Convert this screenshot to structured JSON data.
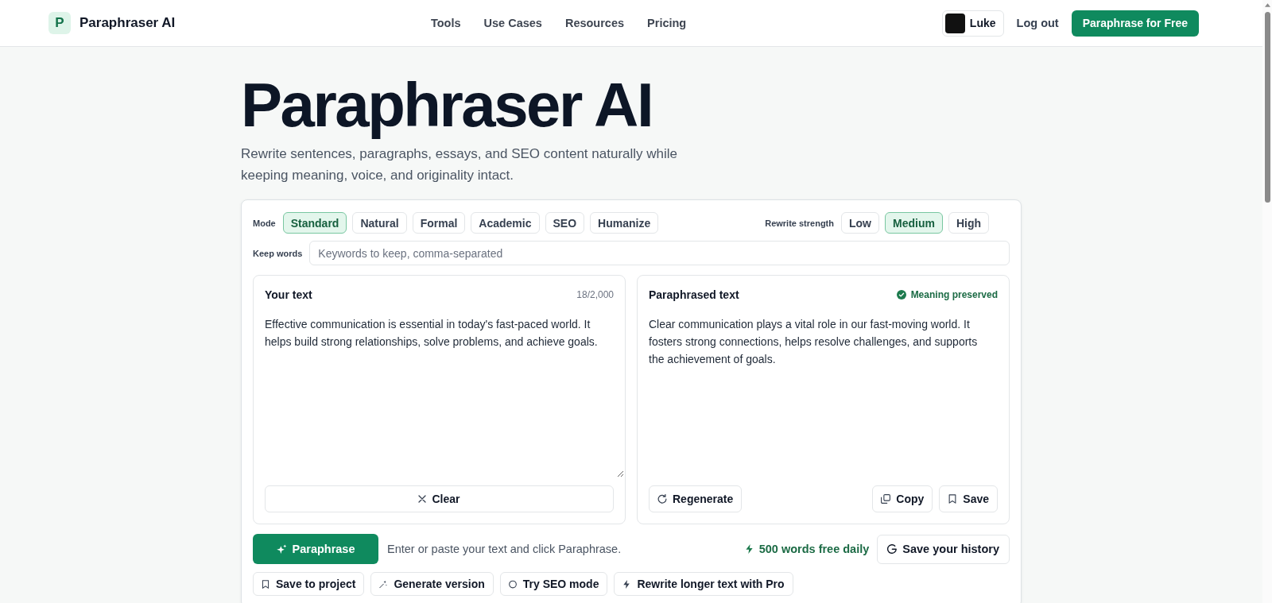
{
  "header": {
    "logo_letter": "P",
    "brand": "Paraphraser AI",
    "nav": [
      {
        "label": "Tools"
      },
      {
        "label": "Use Cases"
      },
      {
        "label": "Resources"
      },
      {
        "label": "Pricing"
      }
    ],
    "user": {
      "name": "Luke"
    },
    "logout": "Log out",
    "cta": "Paraphrase for Free"
  },
  "hero": {
    "title": "Paraphraser AI",
    "subtitle": "Rewrite sentences, paragraphs, essays, and SEO content naturally while keeping meaning, voice, and originality intact."
  },
  "controls": {
    "mode_label": "Mode",
    "modes": [
      {
        "label": "Standard",
        "selected": true
      },
      {
        "label": "Natural",
        "selected": false
      },
      {
        "label": "Formal",
        "selected": false
      },
      {
        "label": "Academic",
        "selected": false
      },
      {
        "label": "SEO",
        "selected": false
      },
      {
        "label": "Humanize",
        "selected": false
      }
    ],
    "strength_label": "Rewrite strength",
    "strengths": [
      {
        "label": "Low",
        "selected": false
      },
      {
        "label": "Medium",
        "selected": true
      },
      {
        "label": "High",
        "selected": false
      }
    ],
    "keep_words": {
      "label": "Keep words",
      "placeholder": "Keywords to keep, comma-separated"
    }
  },
  "input_panel": {
    "title": "Your text",
    "count": "18/2,000",
    "value": "Effective communication is essential in today's fast-paced world. It helps build strong relationships, solve problems, and achieve goals.",
    "clear": "Clear"
  },
  "output_panel": {
    "title": "Paraphrased text",
    "status": "Meaning preserved",
    "text": "Clear communication plays a vital role in our fast-moving world. It fosters strong connections, helps resolve challenges, and supports the achievement of goals.",
    "actions": [
      {
        "label": "Regenerate",
        "kind": "regenerate"
      },
      {
        "label": "Copy",
        "kind": "copy"
      },
      {
        "label": "Save",
        "kind": "save"
      }
    ]
  },
  "action_bar": {
    "paraphrase": "Paraphrase",
    "hint": "Enter or paste your text and click Paraphrase.",
    "quota": "500 words free daily",
    "history": "Save your history"
  },
  "extras": [
    {
      "label": "Save to project",
      "kind": "bookmark"
    },
    {
      "label": "Generate version",
      "kind": "wand"
    },
    {
      "label": "Try SEO mode",
      "kind": "circle"
    },
    {
      "label": "Rewrite longer text with Pro",
      "kind": "bolt"
    }
  ]
}
